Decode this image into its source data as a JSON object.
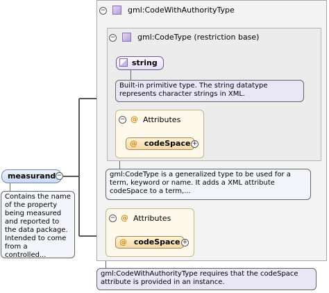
{
  "outer_type": {
    "title": "gml:CodeWithAuthorityType",
    "note": "gml:CodeWithAuthorityType requires that the codeSpace attribute is provided in an instance."
  },
  "inner_type": {
    "title": "gml:CodeType (restriction base)",
    "base_label": "string",
    "base_note": "Built-in primitive type. The string datatype represents character strings in XML.",
    "attributes_label": "Attributes",
    "attribute": "codeSpace",
    "note": "gml:CodeType is a generalized type to be used for a term, keyword or name. It adds a XML attribute codeSpace to a term,..."
  },
  "outer_attributes": {
    "label": "Attributes",
    "attribute": "codeSpace"
  },
  "element": {
    "name": "measurand",
    "note": "Contains the name of the property being measured and reported to the data package. Intended to come from a controlled..."
  },
  "icons": {
    "collapse": "−",
    "expand": "+",
    "attribute_marker": "@"
  }
}
